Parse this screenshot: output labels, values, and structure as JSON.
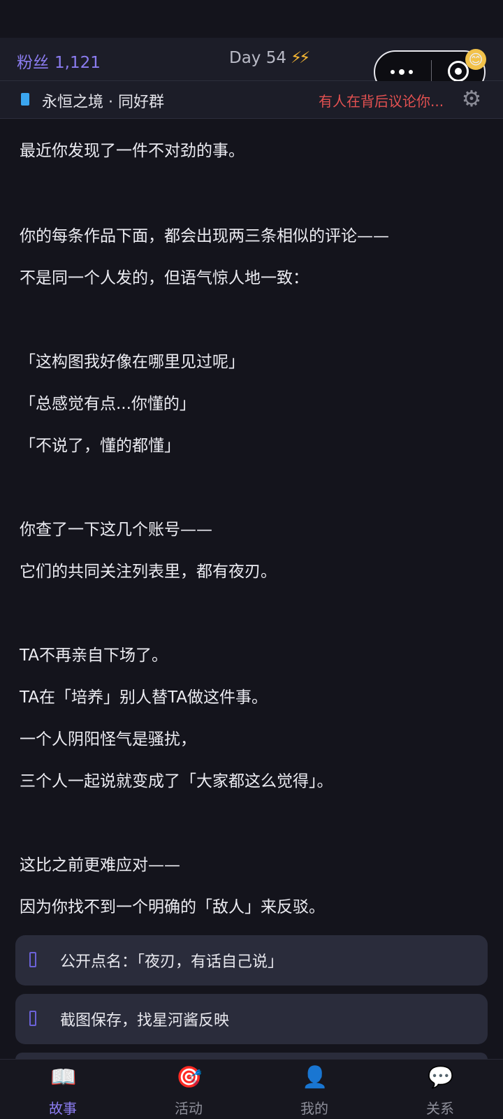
{
  "header": {
    "fans_label": "粉丝",
    "fans_count": "1,121",
    "day_label": "Day 54",
    "day_icon": "⚡⚡"
  },
  "group_bar": {
    "group_name": "永恒之境 · 同好群",
    "alert_text": "有人在背后议论你...",
    "icons": [
      "book-icon",
      "gear-icon"
    ]
  },
  "story": {
    "lines": [
      "最近你发现了一件不对劲的事。",
      "你的每条作品下面，都会出现两三条相似的评论——",
      "不是同一个人发的，但语气惊人地一致：",
      "「这构图我好像在哪里见过呢」",
      "「总感觉有点...你懂的」",
      "「不说了，懂的都懂」",
      "你查了一下这几个账号——",
      "它们的共同关注列表里，都有夜刃。",
      "TA不再亲自下场了。",
      "TA在「培养」别人替TA做这件事。",
      "一个人阴阳怪气是骚扰，",
      "三个人一起说就变成了「大家都这么觉得」。",
      "这比之前更难应对——",
      "因为你找不到一个明确的「敌人」来反驳。"
    ]
  },
  "choices": [
    {
      "label": "公开点名：「夜刃，有话自己说」"
    },
    {
      "label": "截图保存，找星河酱反映"
    }
  ],
  "tabs": [
    {
      "label": "故事",
      "icon": "📖",
      "active": true
    },
    {
      "label": "活动",
      "icon": "🎯",
      "active": false
    },
    {
      "label": "我的",
      "icon": "👤",
      "active": false
    },
    {
      "label": "关系",
      "icon": "💬",
      "active": false
    }
  ],
  "colors": {
    "accent": "#8b7cf0",
    "alert": "#e35151",
    "background": "#14141c"
  }
}
